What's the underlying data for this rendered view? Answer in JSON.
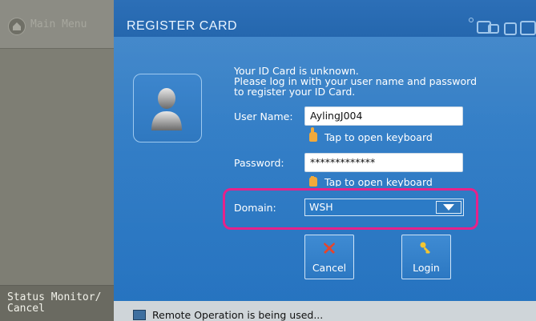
{
  "sidebar": {
    "main_menu_label": "Main Menu",
    "status_label": "Status Monitor/\nCancel"
  },
  "screen": {
    "title": "REGISTER CARD",
    "message_lines": [
      "Your ID Card is unknown.",
      "Please log in with your user name and password",
      "to register your ID Card."
    ]
  },
  "form": {
    "username_label": "User Name:",
    "username_value": "AylingJ004",
    "username_hint": "Tap to open keyboard",
    "password_label": "Password:",
    "password_value": "*************",
    "password_hint": "Tap to open keyboard",
    "domain_label": "Domain:",
    "domain_value": "WSH"
  },
  "buttons": {
    "cancel_label": "Cancel",
    "login_label": "Login"
  },
  "status_bar": {
    "text": "Remote Operation is being used..."
  },
  "colors": {
    "panel_blue": "#2b79c4",
    "highlight_magenta": "#e6228a",
    "sidebar_gray": "#7e7e74"
  },
  "icons": [
    "home-icon",
    "user-avatar-icon",
    "window-controls-icon",
    "hand-pointer-icon",
    "cancel-x-icon",
    "key-icon",
    "monitor-icon"
  ]
}
